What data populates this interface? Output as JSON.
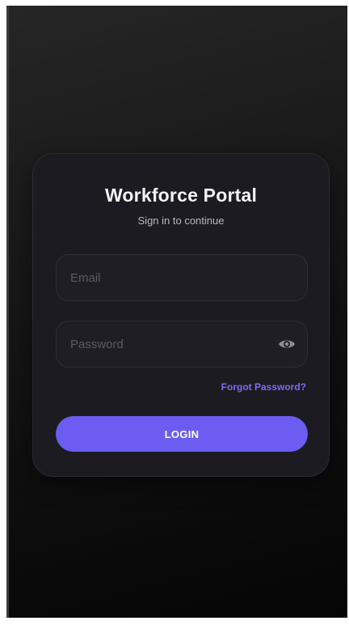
{
  "app": {
    "title": "Workforce Portal",
    "subtitle": "Sign in to continue"
  },
  "form": {
    "email": {
      "placeholder": "Email",
      "value": ""
    },
    "password": {
      "placeholder": "Password",
      "value": "",
      "toggle_icon": "eye-icon"
    },
    "forgot_label": "Forgot Password?",
    "login_label": "LOGIN"
  },
  "colors": {
    "accent": "#6b5cf2",
    "link": "#7f6bf4",
    "card_bg": "#1b1b21",
    "title_text": "#f4f4f6"
  }
}
